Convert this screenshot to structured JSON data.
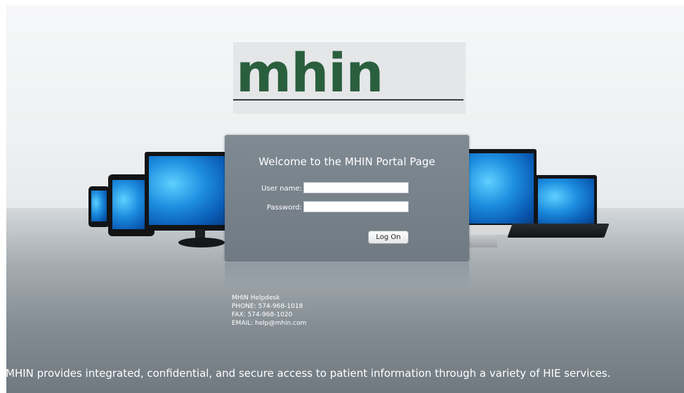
{
  "logo": {
    "text": "mhin"
  },
  "login": {
    "welcome": "Welcome to the MHIN Portal Page",
    "username_label": "User name:",
    "username_value": "",
    "password_label": "Password:",
    "password_value": "",
    "logon_label": "Log On"
  },
  "helpdesk": {
    "title": "MHIN Helpdesk",
    "phone": "PHONE: 574-968-1018",
    "fax": "FAX: 574-968-1020",
    "email": "EMAIL: help@mhin.com"
  },
  "tagline": "MHIN provides integrated, confidential, and secure access to patient information through a variety of HIE services.",
  "colors": {
    "logo_green": "#2a5f3e",
    "panel_gray": "#77828b",
    "screen_blue": "#1e8fe0"
  }
}
